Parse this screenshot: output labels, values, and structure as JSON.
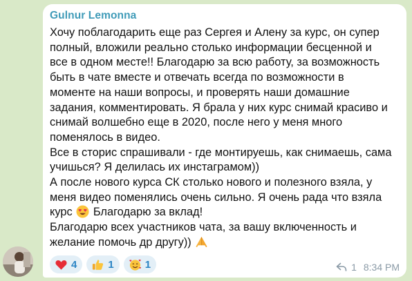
{
  "message": {
    "sender": "Gulnur Lemonna",
    "lines": [
      "Хочу поблагодарить еще раз Сергея и Алену за курс, он супер",
      "полный, вложили реально столько информации бесценной и",
      "все в одном месте!!  Благодарю за всю работу, за возможность",
      "быть в чате вместе и отвечать всегда по возможности в",
      "моменте на наши вопросы, и проверять наши домашние",
      "задания, комментировать. Я брала у них курс снимай красиво и",
      "снимай волшебно еще в 2020, после него у меня много",
      "поменялось в видео.",
      "Все в сторис спрашивали - где монтируешь, как снимаешь, сама",
      "учишься? Я делилась их инстаграмом))",
      "А после нового курса СК столько нового и полезного взяла,  у",
      "меня видео поменялись очень сильно. Я очень рада что взяла"
    ],
    "line_12_before": "курс",
    "line_12_after": "Благодарю за вклад!",
    "line_13": "Благодарю всех участников чата, за вашу включенность и",
    "line_14": "желание помочь др другу))",
    "reactions": [
      {
        "icon": "red-heart-icon",
        "count": "4"
      },
      {
        "icon": "thumbs-up-icon",
        "count": "1"
      },
      {
        "icon": "smiling-face-with-hearts-icon",
        "count": "1"
      }
    ],
    "forwards": "1",
    "time": "8:34 PM"
  }
}
